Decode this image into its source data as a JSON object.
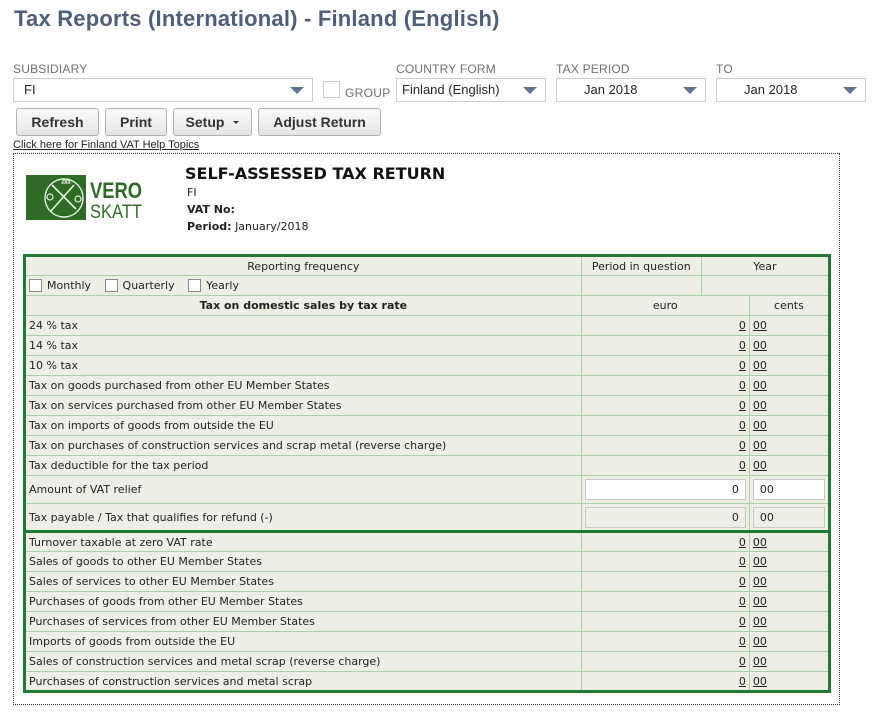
{
  "page_title": "Tax Reports (International) - Finland (English)",
  "filters": {
    "subsidiary": {
      "label": "SUBSIDIARY",
      "value": "FI"
    },
    "group": {
      "label": "GROUP",
      "checked": false
    },
    "country_form": {
      "label": "COUNTRY FORM",
      "value": "Finland (English)"
    },
    "tax_period": {
      "label": "TAX PERIOD",
      "value": "Jan 2018"
    },
    "to": {
      "label": "TO",
      "value": "Jan 2018"
    }
  },
  "toolbar": {
    "refresh": "Refresh",
    "print": "Print",
    "setup": "Setup",
    "adjust_return": "Adjust Return"
  },
  "help_link": "Click here for Finland VAT Help Topics",
  "report": {
    "logo": {
      "line1": "VERO",
      "line2": "SKATT"
    },
    "title": "SELF-ASSESSED TAX RETURN",
    "subsidiary": "FI",
    "vat_no_label": "VAT No:",
    "vat_no_value": "",
    "period_label": "Period:",
    "period_value": "January/2018",
    "reporting_frequency_label": "Reporting frequency",
    "period_in_question_label": "Period in question",
    "year_label": "Year",
    "frequency_options": [
      {
        "label": "Monthly",
        "checked": false
      },
      {
        "label": "Quarterly",
        "checked": false
      },
      {
        "label": "Yearly",
        "checked": false
      }
    ],
    "section_header": "Tax on domestic sales by tax rate",
    "euro_label": "euro",
    "cents_label": "cents",
    "tax_rows": [
      {
        "label": "24 % tax",
        "euro": "0",
        "cents": "00"
      },
      {
        "label": "14 % tax",
        "euro": "0",
        "cents": "00"
      },
      {
        "label": "10 % tax",
        "euro": "0",
        "cents": "00"
      },
      {
        "label": "Tax on goods purchased from other EU Member States",
        "euro": "0",
        "cents": "00"
      },
      {
        "label": "Tax on services purchased from other EU Member States",
        "euro": "0",
        "cents": "00"
      },
      {
        "label": "Tax on imports of goods from outside the EU",
        "euro": "0",
        "cents": "00"
      },
      {
        "label": "Tax on purchases of construction services and scrap metal (reverse charge)",
        "euro": "0",
        "cents": "00"
      },
      {
        "label": "Tax deductible for the tax period",
        "euro": "0",
        "cents": "00"
      }
    ],
    "vat_relief": {
      "label": "Amount of VAT relief",
      "euro": "0",
      "cents": "00"
    },
    "tax_payable": {
      "label": "Tax payable / Tax that qualifies for refund (-)",
      "euro": "0",
      "cents": "00"
    },
    "turnover_rows": [
      {
        "label": "Turnover taxable at zero VAT rate",
        "euro": "0",
        "cents": "00"
      },
      {
        "label": "Sales of goods to other EU Member States",
        "euro": "0",
        "cents": "00"
      },
      {
        "label": "Sales of services to other EU Member States",
        "euro": "0",
        "cents": "00"
      },
      {
        "label": "Purchases of goods from other EU Member States",
        "euro": "0",
        "cents": "00"
      },
      {
        "label": "Purchases of services from other EU Member States",
        "euro": "0",
        "cents": "00"
      },
      {
        "label": "Imports of goods from outside the EU",
        "euro": "0",
        "cents": "00"
      },
      {
        "label": "Sales of construction services and metal scrap (reverse charge)",
        "euro": "0",
        "cents": "00"
      },
      {
        "label": "Purchases of construction services and metal scrap",
        "euro": "0",
        "cents": "00"
      }
    ]
  }
}
